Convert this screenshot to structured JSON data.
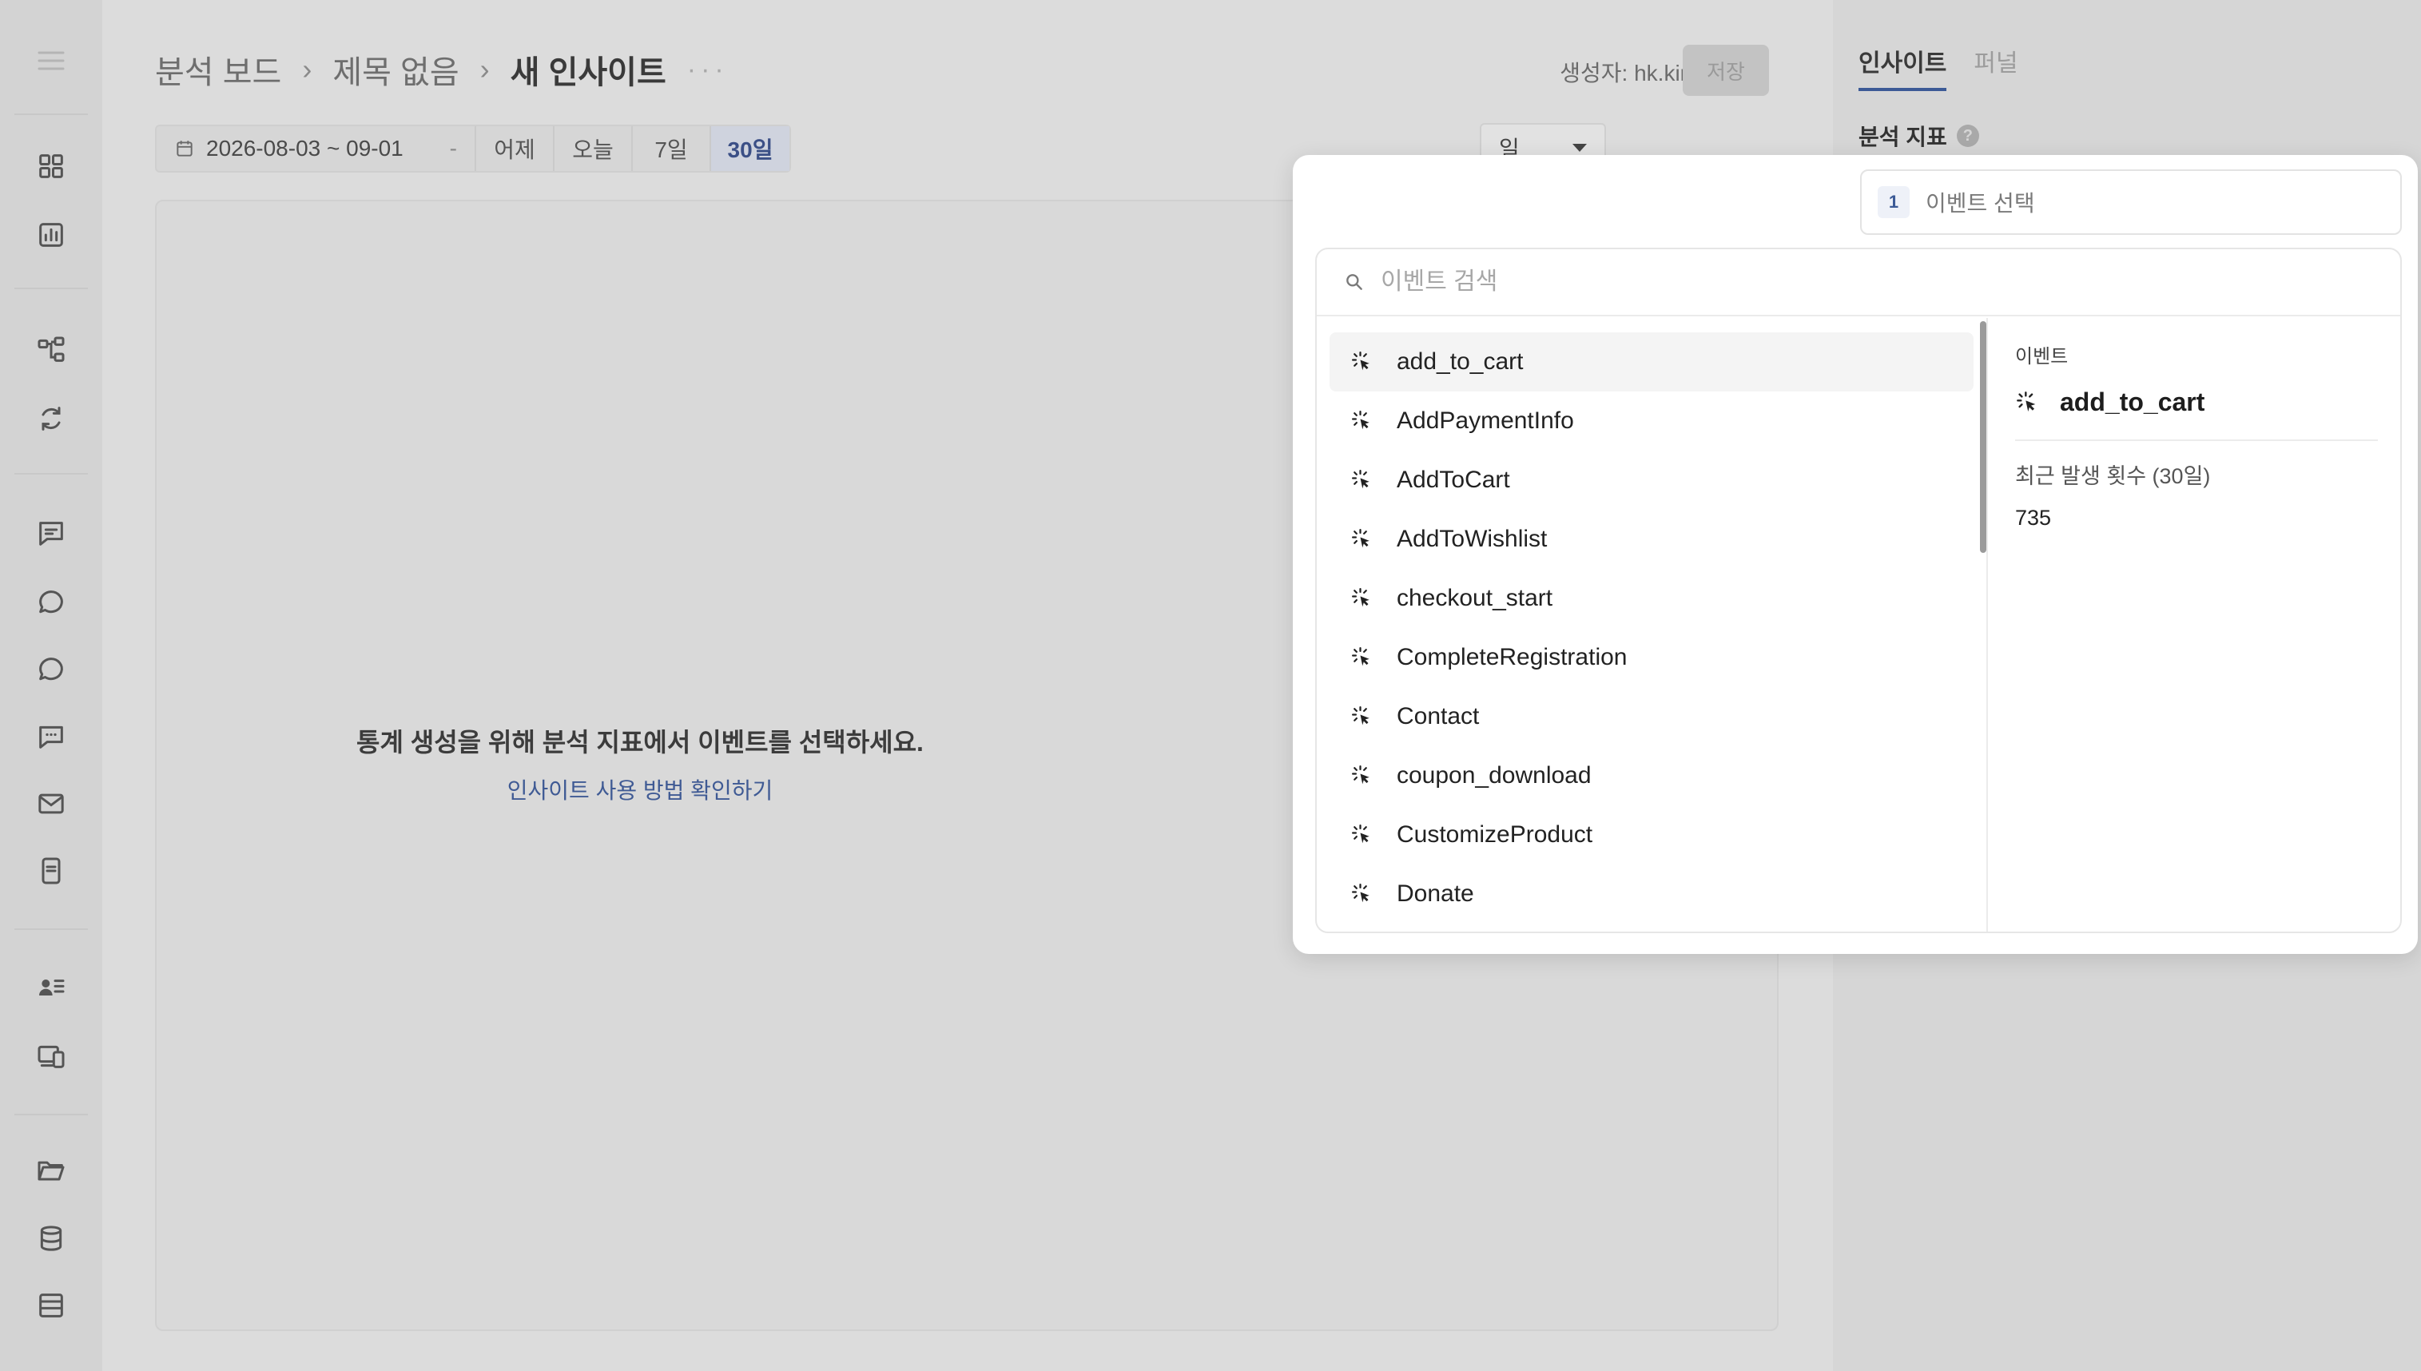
{
  "breadcrumb": {
    "root": "분석 보드",
    "parent": "제목 없음",
    "current": "새 인사이트",
    "more": "···"
  },
  "header": {
    "creator": "생성자: hk.kim",
    "save_label": "저장"
  },
  "date_filter": {
    "range": "2026-08-03 ~ 09-01",
    "caret": "-",
    "quick": [
      "어제",
      "오늘",
      "7일",
      "30일"
    ],
    "active_quick": "30일"
  },
  "unit_select": {
    "value": "일"
  },
  "empty_state": {
    "message": "통계 생성을 위해 분석 지표에서 이벤트를 선택하세요.",
    "link": "인사이트 사용 방법 확인하기"
  },
  "right_panel": {
    "tabs": [
      "인사이트",
      "퍼널"
    ],
    "metric_title": "분석 지표",
    "help": "?"
  },
  "event_select": {
    "number": "1",
    "placeholder": "이벤트 선택"
  },
  "picker": {
    "search_placeholder": "이벤트 검색",
    "events": [
      "add_to_cart",
      "AddPaymentInfo",
      "AddToCart",
      "AddToWishlist",
      "checkout_start",
      "CompleteRegistration",
      "Contact",
      "coupon_download",
      "CustomizeProduct",
      "Donate"
    ],
    "detail": {
      "category": "이벤트",
      "name": "add_to_cart",
      "stat_label": "최근 발생 횟수 (30일)",
      "stat_value": "735"
    }
  },
  "colors": {
    "accent": "#3c5a96",
    "overlay_bg": "#dcdcdc",
    "popover_bg": "#ffffff"
  },
  "icons": {
    "rail": [
      "dashboard-icon",
      "chart-icon",
      "flow-icon",
      "refresh-icon",
      "message-board-icon",
      "chat-bubble-icon",
      "chat-bubble-alt-icon",
      "comment-icon",
      "mail-icon",
      "mobile-icon",
      "user-list-icon",
      "devices-icon",
      "folder-icon",
      "database-icon",
      "table-icon"
    ],
    "event": "click-cursor-icon",
    "search": "search-icon"
  }
}
